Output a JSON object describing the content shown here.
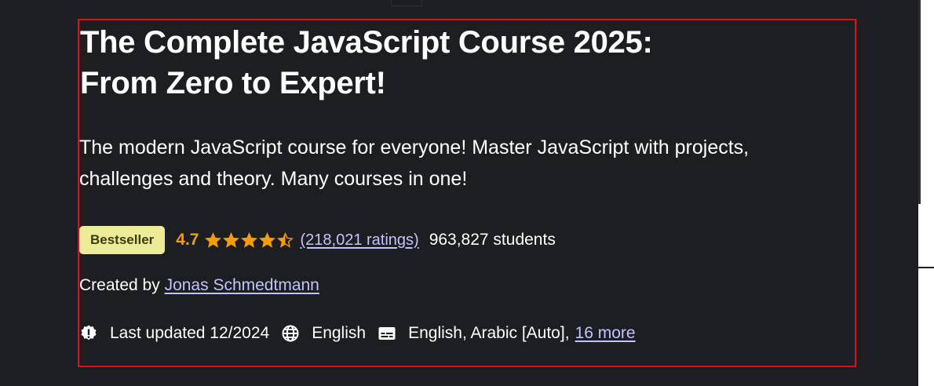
{
  "course": {
    "title_line1": "The Complete JavaScript Course 2025:",
    "title_line2": "From Zero to Expert!",
    "headline_line1": "The modern JavaScript course for everyone! Master JavaScript with projects,",
    "headline_line2": "challenges and theory. Many courses in one!"
  },
  "rating": {
    "badge": "Bestseller",
    "value": "4.7",
    "stars": 4.5,
    "count_label": "(218,021 ratings)",
    "students": "963,827 students"
  },
  "instructor": {
    "prefix": "Created by",
    "name": "Jonas Schmedtmann"
  },
  "meta": {
    "updated": "Last updated 12/2024",
    "language": "English",
    "captions": "English, Arabic [Auto],",
    "captions_more": "16 more",
    "icons": [
      "alert-badge-icon",
      "globe-icon",
      "closed-captions-icon"
    ]
  },
  "colors": {
    "background": "#1d1e21",
    "badge_bg": "#eceb98",
    "rating_orange": "#f69c08",
    "link_purple": "#c0c4fc",
    "highlight_red": "#e0101a"
  }
}
